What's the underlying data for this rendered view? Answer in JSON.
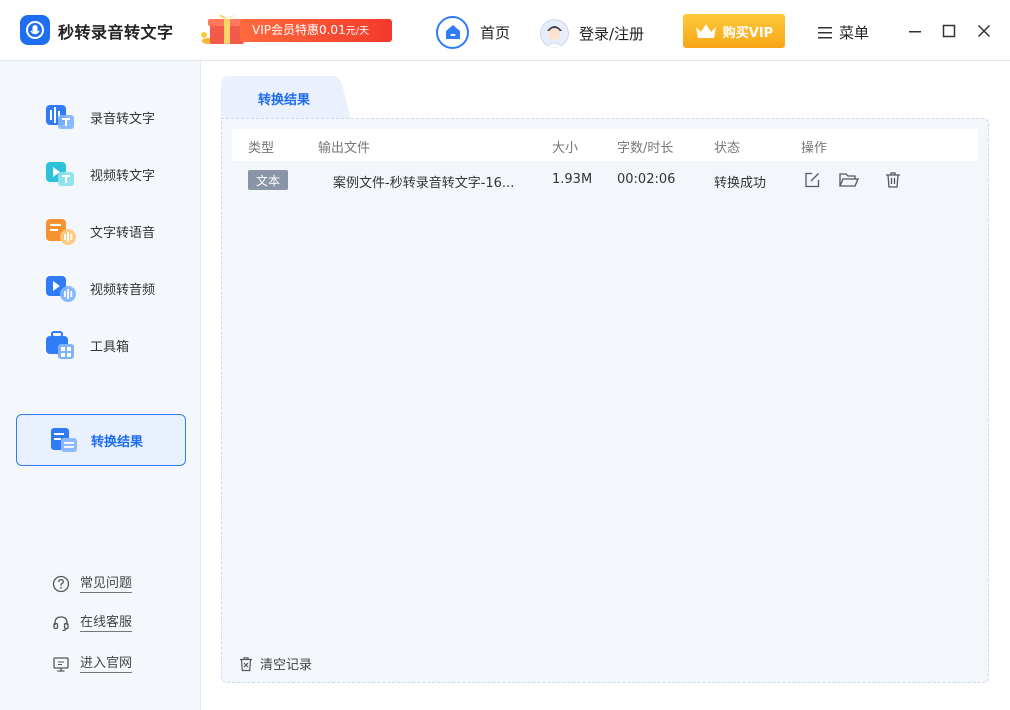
{
  "app": {
    "title": "秒转录音转文字",
    "logo_icon": "app-logo-icon"
  },
  "header": {
    "vip_promo": {
      "text": "VIP会员特惠0.01",
      "unit": "元/天",
      "icon": "gift-box-icon"
    },
    "home_label": "首页",
    "login_label": "登录/注册",
    "buy_vip_label": "购买VIP",
    "menu_label": "菜单",
    "window_controls": [
      "minimize-icon",
      "maximize-icon",
      "close-icon"
    ]
  },
  "sidebar": {
    "items": [
      {
        "label": "录音转文字",
        "icon": "audio-to-text-icon"
      },
      {
        "label": "视频转文字",
        "icon": "video-to-text-icon"
      },
      {
        "label": "文字转语音",
        "icon": "text-to-speech-icon"
      },
      {
        "label": "视频转音频",
        "icon": "video-to-audio-icon"
      },
      {
        "label": "工具箱",
        "icon": "toolbox-icon"
      }
    ],
    "active_item": {
      "label": "转换结果",
      "icon": "result-list-icon"
    },
    "links": [
      {
        "label": "常见问题",
        "icon": "question-icon"
      },
      {
        "label": "在线客服",
        "icon": "headset-icon"
      },
      {
        "label": "进入官网",
        "icon": "monitor-icon"
      }
    ]
  },
  "main": {
    "tab_label": "转换结果",
    "table": {
      "headers": {
        "type": "类型",
        "output": "输出文件",
        "size": "大小",
        "duration": "字数/时长",
        "status": "状态",
        "actions": "操作"
      },
      "rows": [
        {
          "type": "文本",
          "output": "案例文件-秒转录音转文字-16...",
          "size": "1.93M",
          "duration": "00:02:06",
          "status": "转换成功",
          "actions": [
            "edit-icon",
            "open-folder-icon",
            "delete-icon"
          ]
        }
      ]
    },
    "clear_label": "清空记录"
  },
  "colors": {
    "accent": "#1f6df1",
    "sidebar_bg": "#f4f7fc",
    "panel_bg": "#f3f6fb",
    "vip_gold": "#f7a615",
    "promo_red": "#f23a2a"
  }
}
